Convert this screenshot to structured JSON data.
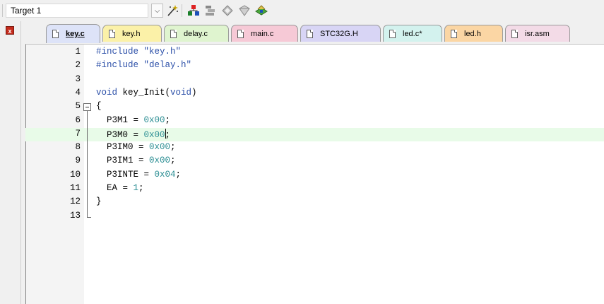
{
  "toolbar": {
    "target_value": "Target 1",
    "target_dropdown_glyph": "⌵",
    "icons": [
      "magic-wand-icon",
      "manage-project-items-icon",
      "file-extensions-icon",
      "diamond-icon",
      "pack-installer-icon",
      "manage-run-time-environment-icon"
    ]
  },
  "tabs": [
    {
      "label": "key.c",
      "active": true,
      "color": "#dde3f8"
    },
    {
      "label": "key.h",
      "active": false,
      "color": "#fbf1a8"
    },
    {
      "label": "delay.c",
      "active": false,
      "color": "#dff4cf"
    },
    {
      "label": "main.c",
      "active": false,
      "color": "#f6c9d6"
    },
    {
      "label": "STC32G.H",
      "active": false,
      "color": "#d8d5f5"
    },
    {
      "label": "led.c*",
      "active": false,
      "color": "#d3f2ee"
    },
    {
      "label": "led.h",
      "active": false,
      "color": "#fbd6a4"
    },
    {
      "label": "isr.asm",
      "active": false,
      "color": "#f3dbe7"
    }
  ],
  "editor": {
    "lines": [
      {
        "n": "1",
        "parts": [
          [
            "kw",
            "#include "
          ],
          [
            "str",
            "\"key.h\""
          ]
        ]
      },
      {
        "n": "2",
        "parts": [
          [
            "kw",
            "#include "
          ],
          [
            "str",
            "\"delay.h\""
          ]
        ]
      },
      {
        "n": "3",
        "parts": []
      },
      {
        "n": "4",
        "parts": [
          [
            "kw",
            "void"
          ],
          [
            "",
            " key_Init("
          ],
          [
            "kw",
            "void"
          ],
          [
            "",
            ")"
          ]
        ]
      },
      {
        "n": "5",
        "parts": [
          [
            "",
            "{"
          ]
        ]
      },
      {
        "n": "6",
        "parts": [
          [
            "",
            "  P3M1 = "
          ],
          [
            "num",
            "0x00"
          ],
          [
            "",
            ";"
          ]
        ]
      },
      {
        "n": "7",
        "parts": [
          [
            "",
            "  P3M0 = "
          ],
          [
            "num",
            "0x00"
          ],
          [
            "caret",
            ""
          ],
          [
            "",
            ";"
          ]
        ]
      },
      {
        "n": "8",
        "parts": [
          [
            "",
            "  P3IM0 = "
          ],
          [
            "num",
            "0x00"
          ],
          [
            "",
            ";"
          ]
        ]
      },
      {
        "n": "9",
        "parts": [
          [
            "",
            "  P3IM1 = "
          ],
          [
            "num",
            "0x00"
          ],
          [
            "",
            ";"
          ]
        ]
      },
      {
        "n": "10",
        "parts": [
          [
            "",
            "  P3INTE = "
          ],
          [
            "num",
            "0x04"
          ],
          [
            "",
            ";"
          ]
        ]
      },
      {
        "n": "11",
        "parts": [
          [
            "",
            "  EA = "
          ],
          [
            "num",
            "1"
          ],
          [
            "",
            ";"
          ]
        ]
      },
      {
        "n": "12",
        "parts": [
          [
            "",
            "}"
          ]
        ]
      },
      {
        "n": "13",
        "parts": []
      }
    ],
    "highlighted_line": "7",
    "colors": {
      "keyword": "#2b4fa8",
      "number": "#2b8e93",
      "highlight": "#e8fbe8"
    }
  }
}
